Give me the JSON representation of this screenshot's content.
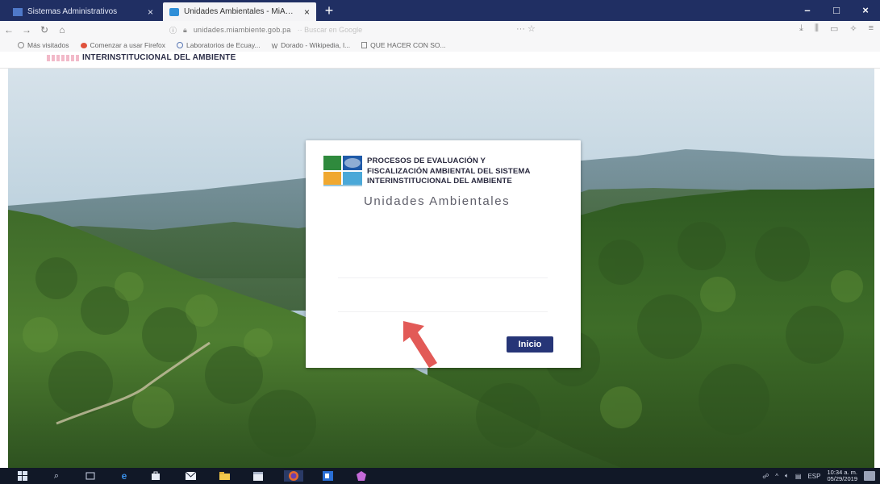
{
  "browser": {
    "tabs": [
      {
        "label": "Sistemas Administrativos",
        "active": false
      },
      {
        "label": "Unidades Ambientales - MiAmbiente",
        "active": true
      }
    ],
    "new_tab_label": "+",
    "window_controls": {
      "minimize": "–",
      "maximize": "□",
      "close": "×"
    },
    "url": "unidades.miambiente.gob.pa",
    "url_tail": "·· Buscar en Google",
    "url_actions": "··· ☆",
    "bookmarks": [
      {
        "label": "Más visitados"
      },
      {
        "label": "Comenzar a usar Firefox"
      },
      {
        "label": "Laboratorios de Ecuay..."
      },
      {
        "label": "Dorado - Wikipedia, l..."
      },
      {
        "label": "QUE HACER CON SO..."
      }
    ]
  },
  "header": {
    "title": "INTERINSTITUCIONAL DEL AMBIENTE"
  },
  "card": {
    "title_line1": "PROCESOS DE EVALUACIÓN Y",
    "title_line2": "FISCALIZACIÓN AMBIENTAL DEL SISTEMA",
    "title_line3": "INTERINSTITUCIONAL DEL AMBIENTE",
    "subtitle": "Unidades Ambientales",
    "submit_label": "Inicio"
  },
  "taskbar": {
    "language": "ESP",
    "time": "10:34 a. m.",
    "date": "05/29/2019"
  },
  "colors": {
    "tabstrip": "#202f63",
    "button": "#263577",
    "taskbar": "#111827",
    "arrow": "#e25a57"
  }
}
